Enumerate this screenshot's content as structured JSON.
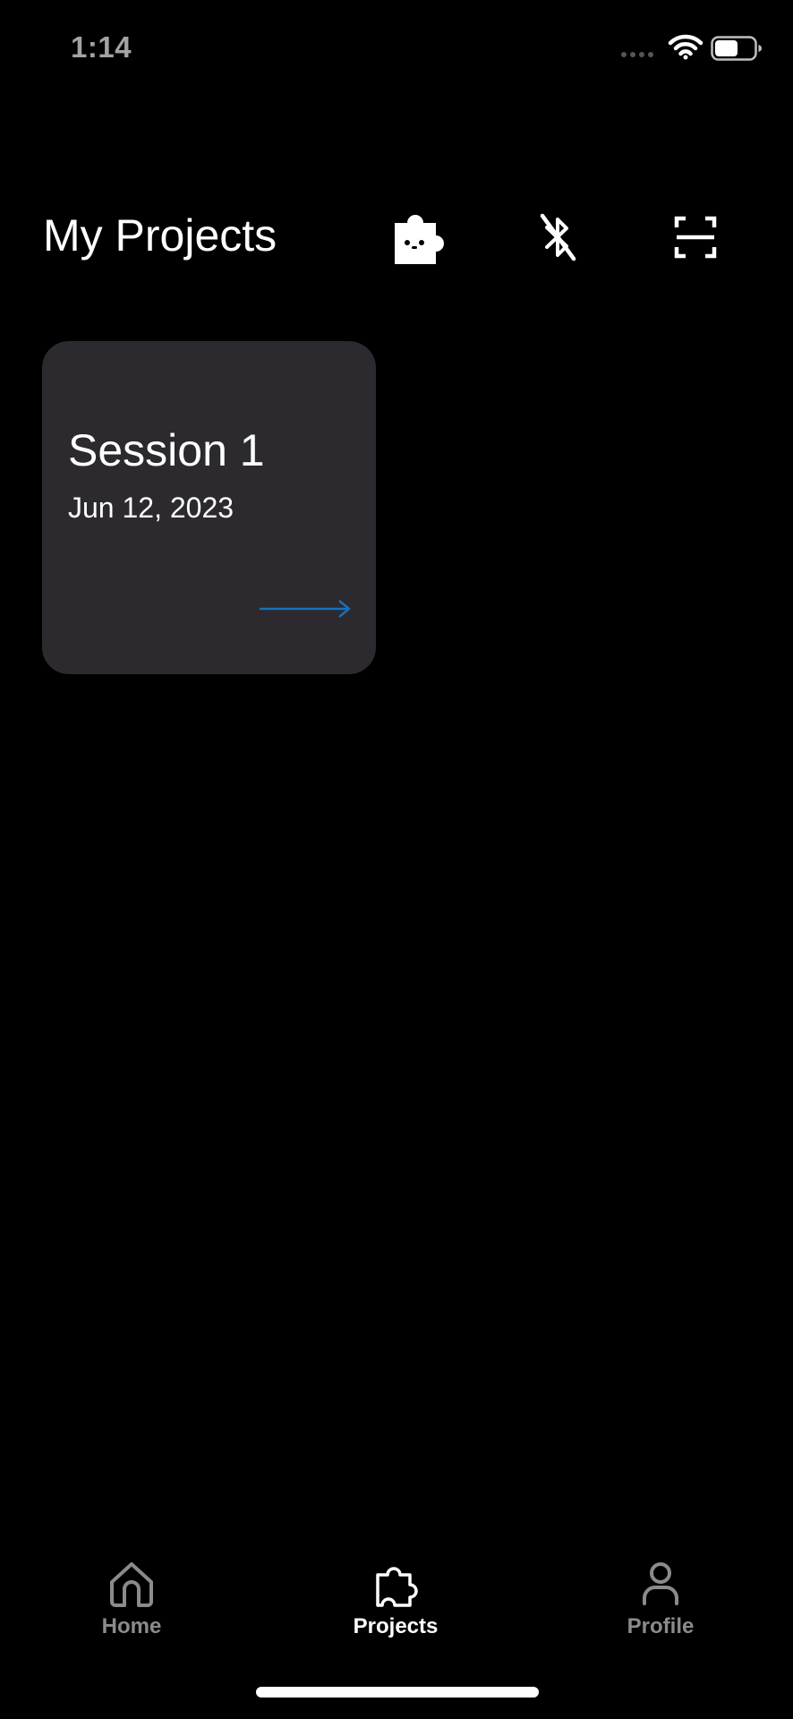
{
  "status_bar": {
    "time": "1:14",
    "battery_level": 0.6
  },
  "header": {
    "title": "My Projects",
    "actions": [
      {
        "icon": "puzzle-face-icon"
      },
      {
        "icon": "bluetooth-off-icon"
      },
      {
        "icon": "scan-frame-icon"
      }
    ]
  },
  "projects": [
    {
      "title": "Session 1",
      "date": "Jun 12, 2023",
      "arrow_icon": "arrow-right-icon"
    }
  ],
  "tab_bar": {
    "tabs": [
      {
        "label": "Home",
        "icon": "home-icon",
        "active": false
      },
      {
        "label": "Projects",
        "icon": "puzzle-icon",
        "active": true
      },
      {
        "label": "Profile",
        "icon": "person-icon",
        "active": false
      }
    ]
  },
  "colors": {
    "background": "#000000",
    "card": "#2c2a2e",
    "accent_arrow": "#1a6fb8",
    "tab_active": "#ffffff",
    "tab_inactive": "#8b8b8b"
  }
}
